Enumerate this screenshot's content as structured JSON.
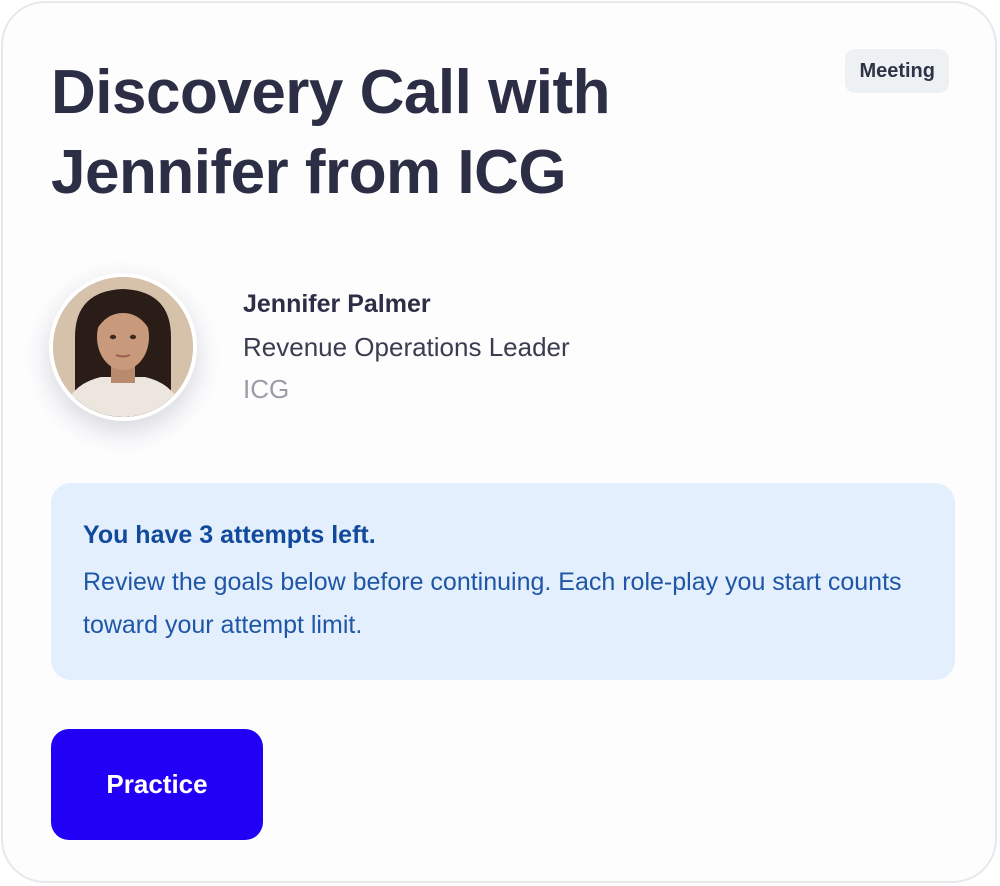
{
  "card": {
    "title": "Discovery Call with Jennifer from ICG",
    "badge": "Meeting"
  },
  "persona": {
    "name": "Jennifer Palmer",
    "role": "Revenue Operations Leader",
    "company": "ICG"
  },
  "notice": {
    "title": "You have 3 attempts left.",
    "body": "Review the goals below before continuing. Each role-play you start counts toward your attempt limit."
  },
  "actions": {
    "practice_label": "Practice"
  },
  "colors": {
    "primary": "#2100F5",
    "notice_background": "#E3EFFC",
    "notice_text": "#114A9C",
    "title_text": "#2B2E45",
    "badge_background": "#EEF1F4"
  }
}
